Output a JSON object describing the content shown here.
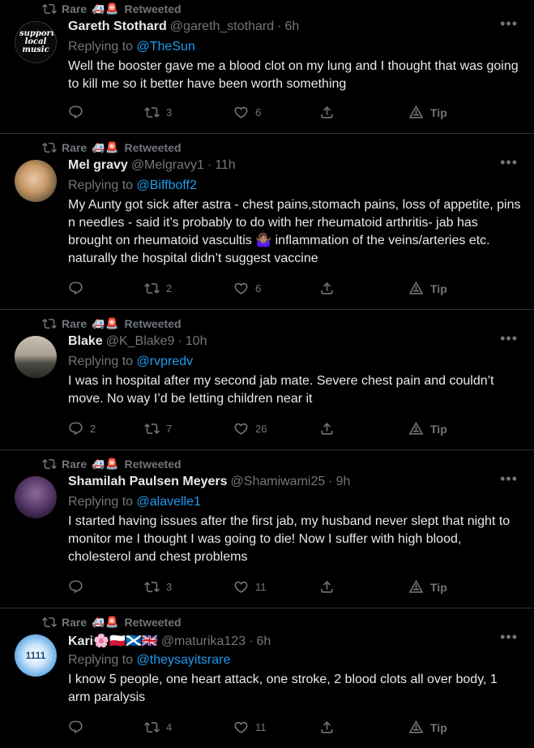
{
  "colors": {
    "background": "#000000",
    "text": "#e7e9ea",
    "muted": "#71767b",
    "link": "#1d9bf0",
    "divider": "#2f3336"
  },
  "retweet_context": {
    "user": "Rare",
    "emoji": "🚑🚨",
    "label": "Retweeted"
  },
  "actions": {
    "tip_label": "Tip",
    "replying_prefix": "Replying to"
  },
  "tweets": [
    {
      "name": "Gareth Stothard",
      "handle": "@gareth_stothard",
      "dot": "·",
      "time": "6h",
      "reply_to": "@TheSun",
      "text": "Well the booster gave me a blood clot on my lung and I thought that was going to kill me so it better have been worth something",
      "replies": "",
      "retweets": "3",
      "likes": "6",
      "avatar_text": "support local music"
    },
    {
      "name": "Mel gravy",
      "handle": "@Melgravy1",
      "dot": "·",
      "time": "11h",
      "reply_to": "@Biffboff2",
      "text": "My Aunty got sick after astra - chest pains,stomach pains, loss of appetite, pins n needles - said it’s probably to do with her rheumatoid arthritis- jab has brought on rheumatoid vascultis 🤷🏽‍♀️ inflammation of the veins/arteries etc. naturally the hospital didn’t suggest vaccine",
      "replies": "",
      "retweets": "2",
      "likes": "6"
    },
    {
      "name": "Blake",
      "handle": "@K_Blake9",
      "dot": "·",
      "time": "10h",
      "reply_to": "@rvpredv",
      "text": "I was in hospital after my second jab mate. Severe chest pain and couldn’t move. No way I’d be letting children near it",
      "replies": "2",
      "retweets": "7",
      "likes": "26"
    },
    {
      "name": "Shamilah Paulsen Meyers",
      "handle": "@Shamiwami25",
      "dot": "·",
      "time": "9h",
      "reply_to": "@alavelle1",
      "text": "I started having issues after the first jab, my husband never slept that night to monitor me I thought I was going to die! Now I suffer with high blood, cholesterol and chest problems",
      "replies": "",
      "retweets": "3",
      "likes": "11"
    },
    {
      "name": "Kari🌸🇵🇱🏴󠁧󠁢󠁳󠁣󠁴󠁿🇬🇧",
      "handle": "@maturika123",
      "dot": "·",
      "time": "6h",
      "reply_to": "@theysayitsrare",
      "text": "I know 5 people, one heart attack, one stroke, 2 blood clots all over body, 1 arm paralysis",
      "replies": "",
      "retweets": "4",
      "likes": "11",
      "avatar_text": "1111"
    }
  ]
}
